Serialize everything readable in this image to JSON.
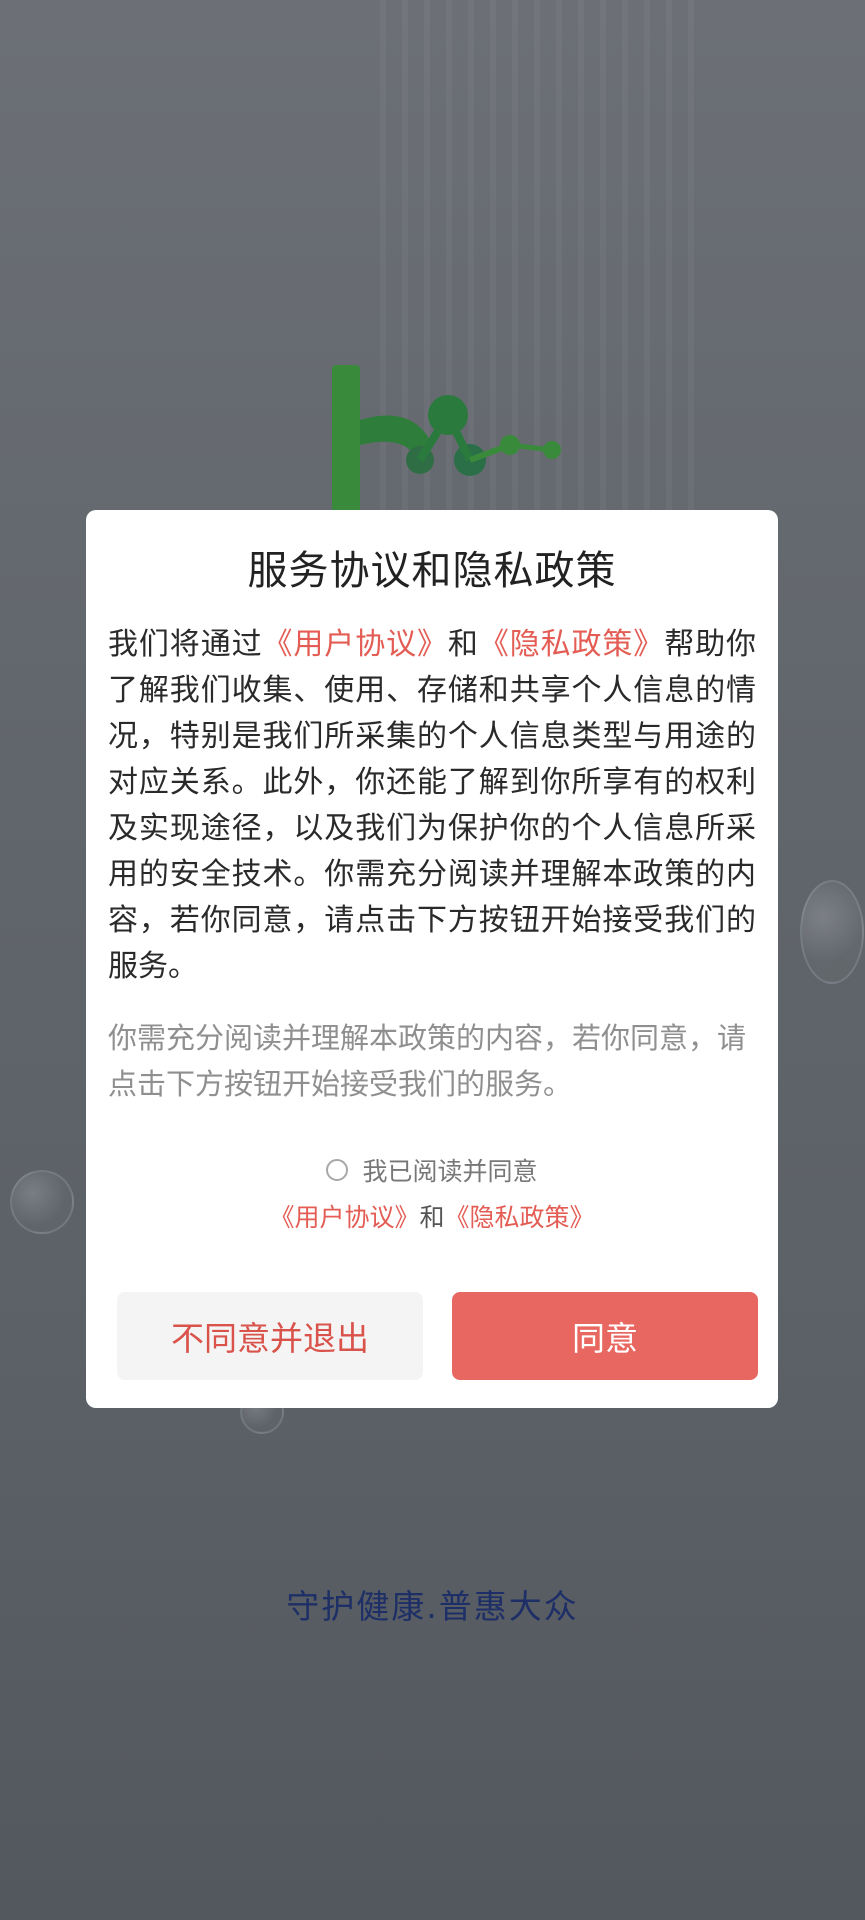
{
  "app": {
    "slogan": "守护健康.普惠大众"
  },
  "dialog": {
    "title": "服务协议和隐私政策",
    "body": {
      "p1": "我们将通过",
      "link1": "《用户协议》",
      "p2": "和",
      "link2": "《隐私政策》",
      "p3": "帮助你了解我们收集、使用、存储和共享个人信息的情况，特别是我们所采集的个人信息类型与用途的对应关系。此外，你还能了解到你所享有的权利及实现途径，以及我们为保护你的个人信息所采用的安全技术。你需充分阅读并理解本政策的内容，若你同意，请点击下方按钮开始接受我们的服务。"
    },
    "note": "你需充分阅读并理解本政策的内容，若你同意，请点击下方按钮开始接受我们的服务。",
    "agree": {
      "label": "我已阅读并同意",
      "checked": false,
      "link1": "《用户协议》",
      "and": "和",
      "link2": "《隐私政策》"
    },
    "buttons": {
      "decline": "不同意并退出",
      "accept": "同意"
    }
  },
  "colors": {
    "accent": "#e86861",
    "link": "#e35d55",
    "logo_green": "#3a8a3c",
    "slogan": "#1d2f66"
  }
}
